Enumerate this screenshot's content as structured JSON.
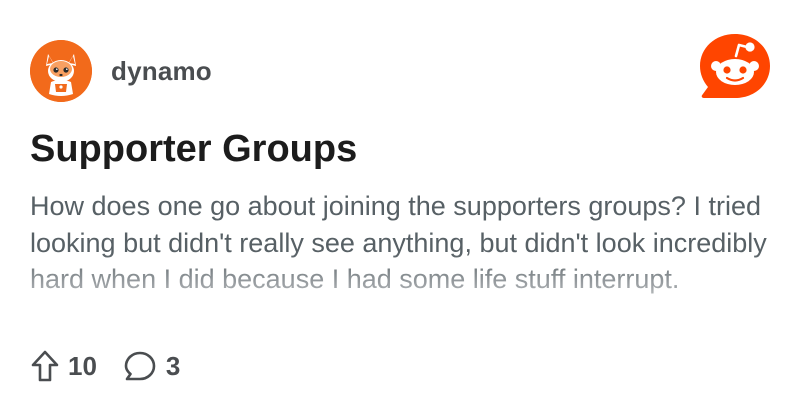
{
  "post": {
    "username": "dynamo",
    "title": "Supporter Groups",
    "body": "How does one go about joining the supporters groups? I tried looking but didn't really see anything, but didn't look incredibly hard when I did because I had some life stuff interrupt.",
    "upvotes": "10",
    "comments": "3"
  },
  "icons": {
    "avatar": "fox-avatar",
    "logo": "reddit-snoo-logo",
    "upvote": "upvote-arrow-icon",
    "comment": "comment-bubble-icon"
  },
  "colors": {
    "brand": "#ff4500",
    "avatar_bg": "#f26a1b",
    "muted_text": "#576065"
  }
}
